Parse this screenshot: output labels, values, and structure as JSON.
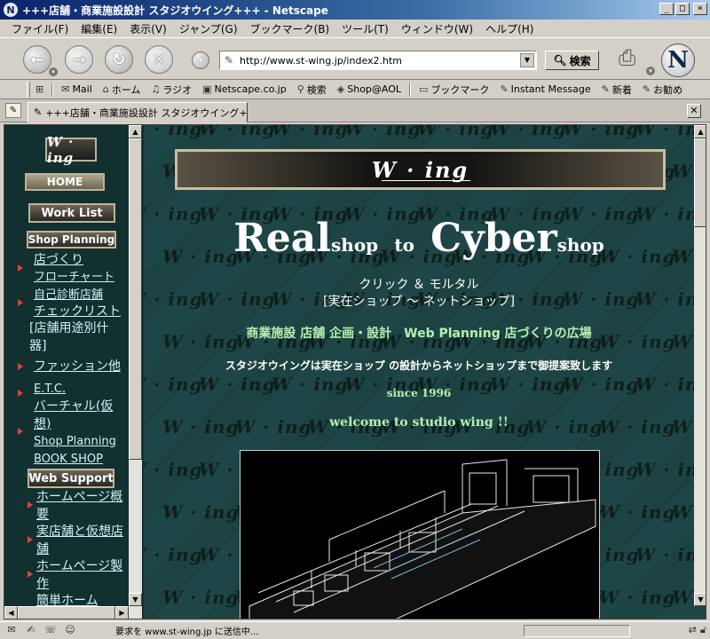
{
  "window": {
    "title": "+++店舗・商業施設設計 スタジオウイング+++ - Netscape"
  },
  "menu": [
    "ファイル(F)",
    "編集(E)",
    "表示(V)",
    "ジャンプ(G)",
    "ブックマーク(B)",
    "ツール(T)",
    "ウィンドウ(W)",
    "ヘルプ(H)"
  ],
  "nav": {
    "url": "http://www.st-wing.jp/index2.htm",
    "search_label": "検索"
  },
  "personal_toolbar": [
    "Mail",
    "ホーム",
    "ラジオ",
    "Netscape.co.jp",
    "検索",
    "Shop@AOL",
    "ブックマーク",
    "Instant Message",
    "新着",
    "お勧め"
  ],
  "tab": {
    "title": "+++店舗・商業施設設計 スタジオウイング+++"
  },
  "sidebar": {
    "logo": "W · ing",
    "home": "HOME",
    "work_list": "Work List",
    "shop_planning": "Shop Planning",
    "links": [
      "店づくり",
      "フローチャート",
      "自己診断店舗",
      "チェックリスト"
    ],
    "category_text": "[店舗用途別什器]",
    "fashion": "ファッション他",
    "etc": "E.T.C.",
    "virtual": "バーチャル(仮想)",
    "shop_planning_book": "Shop Planning BOOK SHOP",
    "web_support": "Web Support",
    "links2": [
      "ホームページ概要",
      "実店舗と仮想店舗",
      "ホームページ製作",
      "簡単ホーム"
    ]
  },
  "main": {
    "banner_logo": "W · ing",
    "hero": {
      "real": "Real",
      "shop1": "shop",
      "to": "to",
      "cyber": "Cyber",
      "shop2": "shop"
    },
    "click_mortar": "クリック ＆ モルタル",
    "subtitle": "[実在ショップ 〜 ネットショップ]",
    "tagline": "商業施設 店舗 企画・設計　Web Planning 店づくりの広場",
    "description": "スタジオウイングは実在ショップ の設計からネットショップまで御提案致します",
    "since": "since 1996",
    "welcome": "welcome to studio wing !!",
    "watermark": "W · ing"
  },
  "status": {
    "text": "要求を www.st-wing.jp に送信中..."
  }
}
